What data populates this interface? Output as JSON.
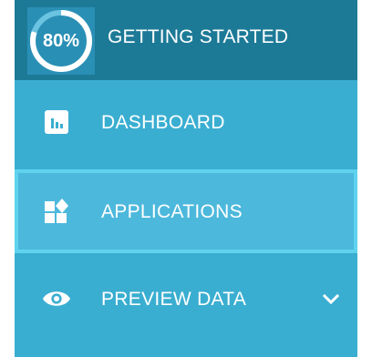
{
  "header": {
    "progress_label": "80%",
    "progress_fraction": 0.8,
    "title": "GETTING STARTED"
  },
  "nav": {
    "items": [
      {
        "label": "DASHBOARD",
        "icon": "bar-chart-icon"
      },
      {
        "label": "APPLICATIONS",
        "icon": "widgets-icon",
        "active": true
      },
      {
        "label": "PREVIEW DATA",
        "icon": "eye-icon",
        "expandable": true,
        "expand_icon": "chevron-down-icon"
      }
    ]
  },
  "colors": {
    "sidebar_bg": "#3aaed1",
    "header_bg": "#1d7a97",
    "active_bg": "#4cb8dc",
    "active_border": "#5fd3ee",
    "text": "#ffffff"
  }
}
